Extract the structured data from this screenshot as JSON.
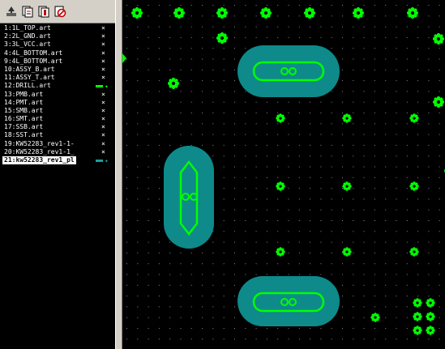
{
  "toolbar": {
    "buttons": [
      {
        "name": "add-layer-icon"
      },
      {
        "name": "copy-layer-icon"
      },
      {
        "name": "layer-props-icon"
      },
      {
        "name": "delete-layer-icon"
      }
    ]
  },
  "layers": [
    {
      "label": "1:1L_TOP.art",
      "mark": "×"
    },
    {
      "label": "2:2L_GND.art",
      "mark": "×"
    },
    {
      "label": "3:3L_VCC.art",
      "mark": "×"
    },
    {
      "label": "4:4L_BOTTOM.art",
      "mark": "×"
    },
    {
      "label": "9:4L_BOTTOM.art",
      "mark": "×"
    },
    {
      "label": "10:ASSY_B.art",
      "mark": "×"
    },
    {
      "label": "11:ASSY_T.art",
      "mark": "×"
    },
    {
      "label": "12:DRILL.art",
      "mark": "",
      "color": "#00ff00"
    },
    {
      "label": "13:PMB.art",
      "mark": "×"
    },
    {
      "label": "14:PMT.art",
      "mark": "×"
    },
    {
      "label": "15:SMB.art",
      "mark": "×"
    },
    {
      "label": "16:SMT.art",
      "mark": "×"
    },
    {
      "label": "17:SSB.art",
      "mark": "×"
    },
    {
      "label": "18:SST.art",
      "mark": "×"
    },
    {
      "label": "19:KW52283_rev1-1-",
      "mark": "×"
    },
    {
      "label": "20:KW52283_rev1-1_",
      "mark": "×"
    },
    {
      "label": "21:kw52283_rev1_pl",
      "mark": "",
      "color": "#1aa0a0",
      "selected": true
    }
  ],
  "colors": {
    "pad": "#00ff00",
    "plane": "#0e8a8a",
    "grid_dot": "#8a8a8a",
    "background": "#000000"
  }
}
